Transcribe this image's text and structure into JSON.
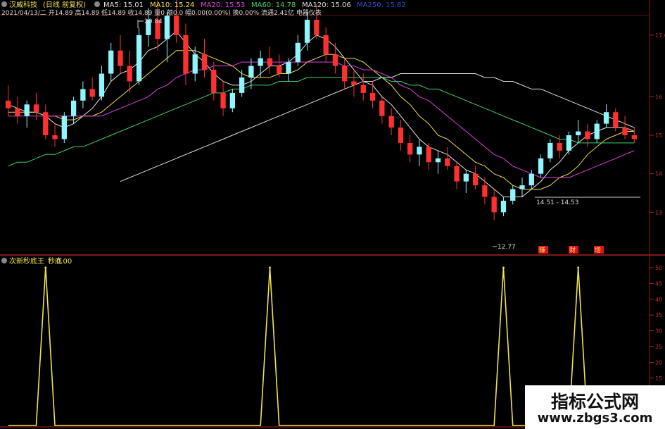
{
  "header": {
    "stock_name": "汉威科技",
    "period": "(日线 前复权)",
    "ma_items": [
      {
        "label": "MA5: 15.01",
        "color": "#e0e0e0"
      },
      {
        "label": "MA10: 15.24",
        "color": "#f2e24a"
      },
      {
        "label": "MA20: 15.53",
        "color": "#e040e0"
      },
      {
        "label": "MA60: 14.78",
        "color": "#3fd16a"
      },
      {
        "label": "MA120: 15.06",
        "color": "#e0e0e0"
      },
      {
        "label": "MA250: 15.82",
        "color": "#2f4bd0"
      }
    ],
    "info_line": "2021/04/13/二 开14.89 高14.89 低14.89 收14.89 量0 额0.0 幅0.00(0.00%) 换0.00% 流通2.41亿 电器仪表"
  },
  "indicator": {
    "name": "次新秒底王",
    "series_label": "秒底",
    "series_value": "0.00"
  },
  "watermark": {
    "title": "指标公式网",
    "url": "www.zbgs3.com"
  },
  "annotations": {
    "high": "20.84",
    "low": "12.77",
    "range": "14.51 - 14.53"
  },
  "bottom_marks": [
    "賺",
    "财",
    "增"
  ],
  "chart_data": [
    {
      "type": "candlestick",
      "title": "",
      "up_color": "#8ff5ff",
      "down_color": "#ff3030",
      "ylim": [
        12,
        18
      ],
      "y_ticks": [
        "17.6",
        "16",
        "15",
        "14",
        "13"
      ],
      "candles": [
        {
          "o": 15.9,
          "h": 16.3,
          "l": 15.5,
          "c": 15.7
        },
        {
          "o": 15.7,
          "h": 16.0,
          "l": 15.3,
          "c": 15.5
        },
        {
          "o": 15.5,
          "h": 15.9,
          "l": 15.2,
          "c": 15.8
        },
        {
          "o": 15.8,
          "h": 16.1,
          "l": 15.4,
          "c": 15.6
        },
        {
          "o": 15.6,
          "h": 15.8,
          "l": 14.9,
          "c": 15.0
        },
        {
          "o": 15.0,
          "h": 15.3,
          "l": 14.7,
          "c": 14.9
        },
        {
          "o": 14.9,
          "h": 15.6,
          "l": 14.8,
          "c": 15.5
        },
        {
          "o": 15.5,
          "h": 16.0,
          "l": 15.3,
          "c": 15.9
        },
        {
          "o": 15.9,
          "h": 16.4,
          "l": 15.7,
          "c": 16.2
        },
        {
          "o": 16.2,
          "h": 16.5,
          "l": 15.9,
          "c": 16.0
        },
        {
          "o": 16.0,
          "h": 16.8,
          "l": 15.9,
          "c": 16.6
        },
        {
          "o": 16.6,
          "h": 17.4,
          "l": 16.4,
          "c": 17.2
        },
        {
          "o": 17.2,
          "h": 17.6,
          "l": 16.6,
          "c": 16.8
        },
        {
          "o": 16.8,
          "h": 17.2,
          "l": 16.1,
          "c": 16.4
        },
        {
          "o": 16.4,
          "h": 17.8,
          "l": 16.3,
          "c": 17.6
        },
        {
          "o": 17.6,
          "h": 18.3,
          "l": 17.3,
          "c": 18.0
        },
        {
          "o": 18.0,
          "h": 18.5,
          "l": 17.2,
          "c": 17.5
        },
        {
          "o": 17.5,
          "h": 18.2,
          "l": 16.9,
          "c": 18.1
        },
        {
          "o": 18.1,
          "h": 18.6,
          "l": 17.4,
          "c": 17.6
        },
        {
          "o": 17.6,
          "h": 17.9,
          "l": 16.3,
          "c": 16.6
        },
        {
          "o": 16.6,
          "h": 17.3,
          "l": 16.4,
          "c": 17.1
        },
        {
          "o": 17.1,
          "h": 17.5,
          "l": 16.5,
          "c": 16.7
        },
        {
          "o": 16.7,
          "h": 16.9,
          "l": 15.9,
          "c": 16.1
        },
        {
          "o": 16.1,
          "h": 16.4,
          "l": 15.5,
          "c": 15.7
        },
        {
          "o": 15.7,
          "h": 16.2,
          "l": 15.6,
          "c": 16.1
        },
        {
          "o": 16.1,
          "h": 16.7,
          "l": 16.0,
          "c": 16.5
        },
        {
          "o": 16.5,
          "h": 17.0,
          "l": 16.2,
          "c": 16.8
        },
        {
          "o": 16.8,
          "h": 17.2,
          "l": 16.5,
          "c": 17.0
        },
        {
          "o": 17.0,
          "h": 17.3,
          "l": 16.6,
          "c": 16.8
        },
        {
          "o": 16.8,
          "h": 17.1,
          "l": 16.5,
          "c": 16.6
        },
        {
          "o": 16.6,
          "h": 17.0,
          "l": 16.4,
          "c": 16.9
        },
        {
          "o": 16.9,
          "h": 17.6,
          "l": 16.8,
          "c": 17.4
        },
        {
          "o": 17.4,
          "h": 18.2,
          "l": 17.2,
          "c": 18.0
        },
        {
          "o": 18.0,
          "h": 18.4,
          "l": 17.5,
          "c": 17.6
        },
        {
          "o": 17.6,
          "h": 17.8,
          "l": 16.9,
          "c": 17.1
        },
        {
          "o": 17.1,
          "h": 17.4,
          "l": 16.6,
          "c": 16.8
        },
        {
          "o": 16.8,
          "h": 17.0,
          "l": 16.2,
          "c": 16.4
        },
        {
          "o": 16.4,
          "h": 16.7,
          "l": 16.0,
          "c": 16.3
        },
        {
          "o": 16.3,
          "h": 16.6,
          "l": 15.9,
          "c": 16.1
        },
        {
          "o": 16.1,
          "h": 16.4,
          "l": 15.7,
          "c": 15.9
        },
        {
          "o": 15.9,
          "h": 16.0,
          "l": 15.3,
          "c": 15.5
        },
        {
          "o": 15.5,
          "h": 15.7,
          "l": 15.0,
          "c": 15.2
        },
        {
          "o": 15.2,
          "h": 15.4,
          "l": 14.6,
          "c": 14.8
        },
        {
          "o": 14.8,
          "h": 15.0,
          "l": 14.3,
          "c": 14.5
        },
        {
          "o": 14.5,
          "h": 14.9,
          "l": 14.2,
          "c": 14.7
        },
        {
          "o": 14.7,
          "h": 14.8,
          "l": 14.1,
          "c": 14.3
        },
        {
          "o": 14.3,
          "h": 14.6,
          "l": 14.0,
          "c": 14.4
        },
        {
          "o": 14.4,
          "h": 14.7,
          "l": 14.1,
          "c": 14.2
        },
        {
          "o": 14.2,
          "h": 14.3,
          "l": 13.6,
          "c": 13.8
        },
        {
          "o": 13.8,
          "h": 14.1,
          "l": 13.5,
          "c": 14.0
        },
        {
          "o": 14.0,
          "h": 14.2,
          "l": 13.6,
          "c": 13.7
        },
        {
          "o": 13.7,
          "h": 13.9,
          "l": 13.2,
          "c": 13.4
        },
        {
          "o": 13.4,
          "h": 13.6,
          "l": 12.8,
          "c": 13.0
        },
        {
          "o": 13.0,
          "h": 13.4,
          "l": 12.9,
          "c": 13.3
        },
        {
          "o": 13.3,
          "h": 13.7,
          "l": 13.2,
          "c": 13.6
        },
        {
          "o": 13.6,
          "h": 13.9,
          "l": 13.4,
          "c": 13.7
        },
        {
          "o": 13.7,
          "h": 14.1,
          "l": 13.6,
          "c": 14.0
        },
        {
          "o": 14.0,
          "h": 14.5,
          "l": 13.9,
          "c": 14.4
        },
        {
          "o": 14.4,
          "h": 14.9,
          "l": 14.3,
          "c": 14.8
        },
        {
          "o": 14.8,
          "h": 15.0,
          "l": 14.4,
          "c": 14.6
        },
        {
          "o": 14.6,
          "h": 15.1,
          "l": 14.5,
          "c": 15.0
        },
        {
          "o": 15.0,
          "h": 15.4,
          "l": 14.8,
          "c": 15.1
        },
        {
          "o": 15.1,
          "h": 15.3,
          "l": 14.7,
          "c": 14.9
        },
        {
          "o": 14.9,
          "h": 15.4,
          "l": 14.8,
          "c": 15.3
        },
        {
          "o": 15.3,
          "h": 15.8,
          "l": 15.2,
          "c": 15.6
        },
        {
          "o": 15.6,
          "h": 15.7,
          "l": 15.1,
          "c": 15.2
        },
        {
          "o": 15.2,
          "h": 15.5,
          "l": 14.9,
          "c": 15.0
        },
        {
          "o": 15.0,
          "h": 15.2,
          "l": 14.8,
          "c": 14.9
        }
      ],
      "ma_lines": [
        {
          "name": "MA5",
          "color": "#e8e8e8",
          "values": [
            15.8,
            15.7,
            15.6,
            15.6,
            15.5,
            15.3,
            15.2,
            15.3,
            15.5,
            15.7,
            16.0,
            16.4,
            16.6,
            16.7,
            16.9,
            17.2,
            17.3,
            17.5,
            17.7,
            17.4,
            17.1,
            16.9,
            16.6,
            16.4,
            16.3,
            16.3,
            16.4,
            16.6,
            16.8,
            16.8,
            16.9,
            17.1,
            17.4,
            17.6,
            17.5,
            17.3,
            17.0,
            16.7,
            16.4,
            16.3,
            16.0,
            15.8,
            15.5,
            15.2,
            14.9,
            14.7,
            14.6,
            14.5,
            14.3,
            14.1,
            14.0,
            13.8,
            13.6,
            13.4,
            13.4,
            13.4,
            13.6,
            13.8,
            14.1,
            14.3,
            14.6,
            14.8,
            15.0,
            15.1,
            15.2,
            15.2,
            15.2,
            15.1
          ]
        },
        {
          "name": "MA10",
          "color": "#f2e24a",
          "values": [
            15.6,
            15.6,
            15.6,
            15.6,
            15.5,
            15.5,
            15.4,
            15.4,
            15.5,
            15.5,
            15.6,
            15.8,
            16.0,
            16.2,
            16.4,
            16.6,
            16.8,
            17.0,
            17.2,
            17.2,
            17.2,
            17.1,
            17.0,
            16.9,
            16.8,
            16.6,
            16.5,
            16.5,
            16.5,
            16.6,
            16.6,
            16.7,
            16.9,
            17.0,
            17.1,
            17.1,
            17.0,
            17.0,
            16.9,
            16.7,
            16.5,
            16.3,
            16.0,
            15.8,
            15.5,
            15.3,
            15.0,
            14.9,
            14.7,
            14.5,
            14.3,
            14.2,
            14.0,
            13.9,
            13.7,
            13.6,
            13.6,
            13.6,
            13.7,
            13.9,
            14.0,
            14.2,
            14.5,
            14.7,
            14.9,
            15.0,
            15.1,
            15.1
          ]
        },
        {
          "name": "MA20",
          "color": "#e040e0",
          "values": [
            15.5,
            15.5,
            15.5,
            15.5,
            15.5,
            15.5,
            15.5,
            15.5,
            15.5,
            15.5,
            15.5,
            15.6,
            15.7,
            15.8,
            15.9,
            16.0,
            16.2,
            16.3,
            16.5,
            16.6,
            16.7,
            16.7,
            16.8,
            16.8,
            16.8,
            16.9,
            16.9,
            16.9,
            16.9,
            16.9,
            16.9,
            16.9,
            16.9,
            16.9,
            16.9,
            16.9,
            16.8,
            16.8,
            16.7,
            16.7,
            16.6,
            16.5,
            16.3,
            16.2,
            16.0,
            15.9,
            15.7,
            15.5,
            15.3,
            15.1,
            14.9,
            14.7,
            14.5,
            14.4,
            14.2,
            14.1,
            14.0,
            13.9,
            13.9,
            13.9,
            13.9,
            14.0,
            14.1,
            14.2,
            14.3,
            14.4,
            14.5,
            14.6
          ]
        },
        {
          "name": "MA60",
          "color": "#3fd16a",
          "values": [
            14.2,
            14.3,
            14.3,
            14.4,
            14.5,
            14.5,
            14.6,
            14.7,
            14.7,
            14.8,
            14.9,
            15.0,
            15.1,
            15.2,
            15.3,
            15.4,
            15.5,
            15.6,
            15.7,
            15.8,
            15.9,
            16.0,
            16.1,
            16.1,
            16.2,
            16.2,
            16.3,
            16.3,
            16.3,
            16.4,
            16.4,
            16.4,
            16.5,
            16.5,
            16.5,
            16.5,
            16.5,
            16.5,
            16.5,
            16.5,
            16.5,
            16.4,
            16.4,
            16.3,
            16.3,
            16.2,
            16.2,
            16.1,
            16.0,
            15.9,
            15.8,
            15.7,
            15.6,
            15.5,
            15.4,
            15.3,
            15.2,
            15.1,
            15.0,
            14.9,
            14.9,
            14.8,
            14.8,
            14.8,
            14.8,
            14.8,
            14.8,
            14.8
          ]
        },
        {
          "name": "MA120",
          "color": "#e0e0e0",
          "values": [
            null,
            null,
            null,
            null,
            null,
            null,
            null,
            null,
            null,
            null,
            null,
            null,
            13.8,
            13.9,
            14.0,
            14.1,
            14.2,
            14.3,
            14.4,
            14.5,
            14.6,
            14.7,
            14.8,
            14.9,
            15.0,
            15.1,
            15.2,
            15.3,
            15.4,
            15.5,
            15.6,
            15.7,
            15.8,
            15.9,
            16.0,
            16.1,
            16.2,
            16.3,
            16.4,
            16.4,
            16.5,
            16.5,
            16.6,
            16.6,
            16.6,
            16.6,
            16.6,
            16.6,
            16.6,
            16.6,
            16.6,
            16.5,
            16.5,
            16.4,
            16.4,
            16.3,
            16.2,
            16.2,
            16.1,
            16.0,
            15.9,
            15.8,
            15.7,
            15.6,
            15.5,
            15.4,
            15.3,
            15.2
          ]
        }
      ]
    },
    {
      "type": "line",
      "title": "",
      "name": "秒底",
      "color": "#f2e24a",
      "ylim": [
        0,
        50
      ],
      "y_ticks": [
        "50",
        "45",
        "40",
        "35",
        "30",
        "25",
        "20",
        "15",
        "10",
        "5"
      ],
      "x": [
        0,
        1,
        2,
        3,
        4,
        5,
        6,
        7,
        8,
        9,
        10,
        11,
        12,
        13,
        14,
        15,
        16,
        17,
        18,
        19,
        20,
        21,
        22,
        23,
        24,
        25,
        26,
        27,
        28,
        29,
        30,
        31,
        32,
        33,
        34,
        35,
        36,
        37,
        38,
        39,
        40,
        41,
        42,
        43,
        44,
        45,
        46,
        47,
        48,
        49,
        50,
        51,
        52,
        53,
        54,
        55,
        56,
        57,
        58,
        59,
        60,
        61,
        62,
        63,
        64,
        65,
        66,
        67
      ],
      "values": [
        0,
        0,
        0,
        0,
        50,
        0,
        0,
        0,
        0,
        0,
        0,
        0,
        0,
        0,
        0,
        0,
        0,
        0,
        0,
        0,
        0,
        0,
        0,
        0,
        0,
        0,
        0,
        0,
        50,
        0,
        0,
        0,
        0,
        0,
        0,
        0,
        0,
        0,
        0,
        0,
        0,
        0,
        0,
        0,
        0,
        0,
        0,
        0,
        0,
        0,
        0,
        0,
        0,
        50,
        0,
        0,
        0,
        0,
        0,
        0,
        0,
        50,
        0,
        0,
        0,
        0,
        0,
        0
      ]
    }
  ]
}
